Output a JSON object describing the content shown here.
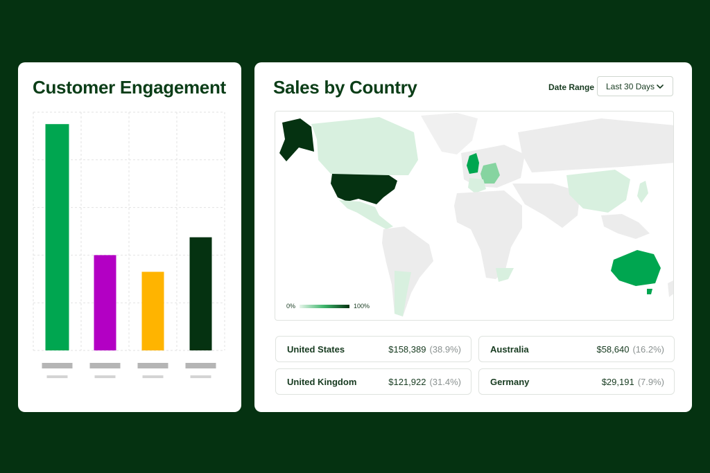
{
  "engagement": {
    "title": "Customer Engagement",
    "chart_data": {
      "type": "bar",
      "categories": [
        "",
        "",
        "",
        ""
      ],
      "values": [
        95,
        40,
        33,
        47.5
      ],
      "ylim": [
        0,
        100
      ],
      "grid": true,
      "colors": [
        "#00a650",
        "#b300c4",
        "#ffb400",
        "#053211"
      ]
    }
  },
  "sales": {
    "title": "Sales by Country",
    "date_range": {
      "label": "Date Range",
      "selected": "Last 30 Days"
    },
    "legend": {
      "min": "0%",
      "max": "100%"
    },
    "countries": [
      {
        "name": "United States",
        "value": "$158,389",
        "pct": "(38.9%)"
      },
      {
        "name": "Australia",
        "value": "$58,640",
        "pct": "(16.2%)"
      },
      {
        "name": "United Kingdom",
        "value": "$121,922",
        "pct": "(31.4%)"
      },
      {
        "name": "Germany",
        "value": "$29,191",
        "pct": "(7.9%)"
      }
    ]
  }
}
